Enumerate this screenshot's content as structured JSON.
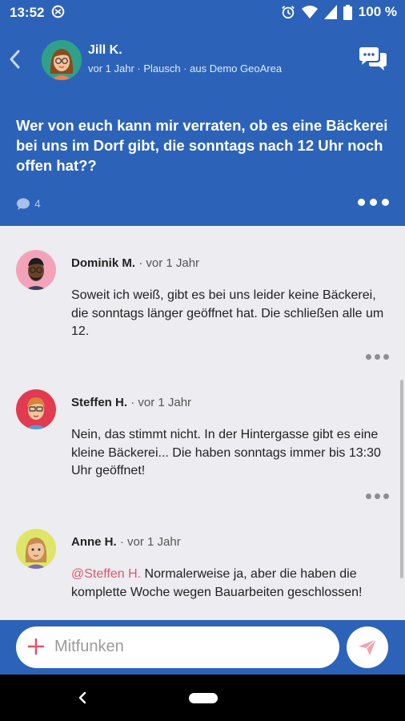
{
  "status_bar": {
    "time": "13:52",
    "battery": "100 %"
  },
  "post": {
    "author": "Jill K.",
    "meta": "vor 1 Jahr · Plausch · aus Demo GeoArea",
    "text": "Wer von euch kann mir verraten, ob es eine Bäckerei bei uns im Dorf gibt, die sonntags nach 12 Uhr noch offen hat??",
    "comment_count": "4"
  },
  "comments": [
    {
      "name": "Dominik M.",
      "time": "· vor 1 Jahr",
      "text": "Soweit ich weiß, gibt es bei uns leider keine Bäckerei, die sonntags länger geöffnet hat. Die schließen alle um 12."
    },
    {
      "name": "Steffen H.",
      "time": "· vor 1 Jahr",
      "text": "Nein, das stimmt nicht. In der Hintergasse gibt es eine kleine Bäckerei... Die haben sonntags immer bis 13:30 Uhr geöffnet!"
    },
    {
      "name": "Anne H.",
      "time": "· vor 1 Jahr",
      "mention": "@Steffen H.",
      "text": " Normalerweise ja, aber die haben die komplette Woche wegen Bauarbeiten geschlossen!"
    }
  ],
  "composer": {
    "placeholder": "Mitfunken"
  },
  "colors": {
    "primary": "#2c63b8",
    "accent": "#e0566a",
    "background": "#ececf1"
  }
}
